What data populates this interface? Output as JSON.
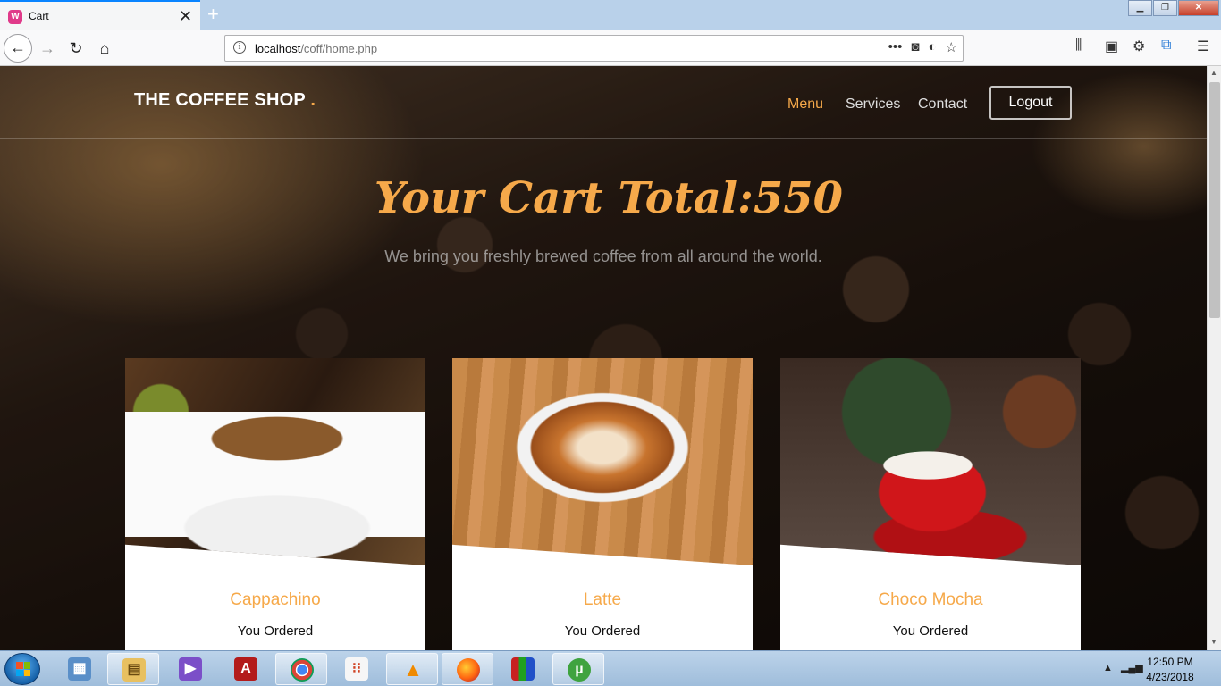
{
  "browser": {
    "tab_title": "Cart",
    "new_tab": "+",
    "url_host": "localhost",
    "url_path": "/coff/home.php"
  },
  "site": {
    "brand": "THE COFFEE SHOP",
    "brand_dot": ".",
    "nav": [
      {
        "label": "Menu",
        "active": true
      },
      {
        "label": "Services",
        "active": false
      },
      {
        "label": "Contact",
        "active": false
      }
    ],
    "logout_label": "Logout",
    "hero_title": "Your Cart Total:550",
    "hero_subtitle": "We bring you freshly brewed coffee from all around the world."
  },
  "cart": {
    "items": [
      {
        "name": "Cappachino",
        "status": "You Ordered"
      },
      {
        "name": "Latte",
        "status": "You Ordered"
      },
      {
        "name": "Choco Mocha",
        "status": "You Ordered"
      }
    ]
  },
  "taskbar": {
    "time": "12:50 PM",
    "date": "4/23/2018"
  },
  "colors": {
    "accent": "#f6a94a",
    "browser_accent": "#0a84ff"
  }
}
